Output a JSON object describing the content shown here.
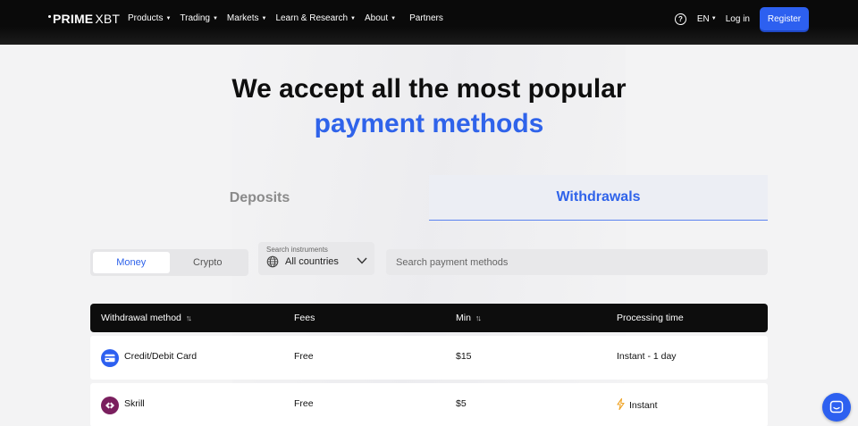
{
  "nav": {
    "logo": "PRIME",
    "logo_suffix": "XBT",
    "items": [
      {
        "label": "Products",
        "has_caret": true
      },
      {
        "label": "Trading",
        "has_caret": true
      },
      {
        "label": "Markets",
        "has_caret": true
      },
      {
        "label": "Learn & Research",
        "has_caret": true
      },
      {
        "label": "About",
        "has_caret": true
      },
      {
        "label": "Partners",
        "has_caret": false
      }
    ],
    "language": "EN",
    "login": "Log in",
    "register": "Register"
  },
  "hero": {
    "title_line1": "We accept all the most popular",
    "title_line2": "payment methods"
  },
  "tabs": {
    "deposits": "Deposits",
    "withdrawals": "Withdrawals",
    "active": "Withdrawals"
  },
  "filters": {
    "segments": [
      "Money",
      "Crypto"
    ],
    "active_segment": "Money",
    "country_label": "Search instruments",
    "country_value": "All countries",
    "search_placeholder": "Search payment methods"
  },
  "table": {
    "headers": [
      "Withdrawal method",
      "Fees",
      "Min",
      "Processing time"
    ],
    "sortable": [
      true,
      false,
      true,
      false
    ],
    "rows": [
      {
        "method": "Credit/Debit Card",
        "icon": "card-icon",
        "fees": "Free",
        "min": "$15",
        "time": "Instant - 1 day",
        "instant_icon": false
      },
      {
        "method": "Skrill",
        "icon": "skrill-icon",
        "fees": "Free",
        "min": "$5",
        "time": "Instant",
        "instant_icon": true
      }
    ]
  },
  "colors": {
    "accent": "#2f63ea",
    "register_bg": "#2d60f0",
    "nav_bg": "#0a0a0a",
    "skrill": "#7a1f5e",
    "bolt": "#f0a52a"
  }
}
